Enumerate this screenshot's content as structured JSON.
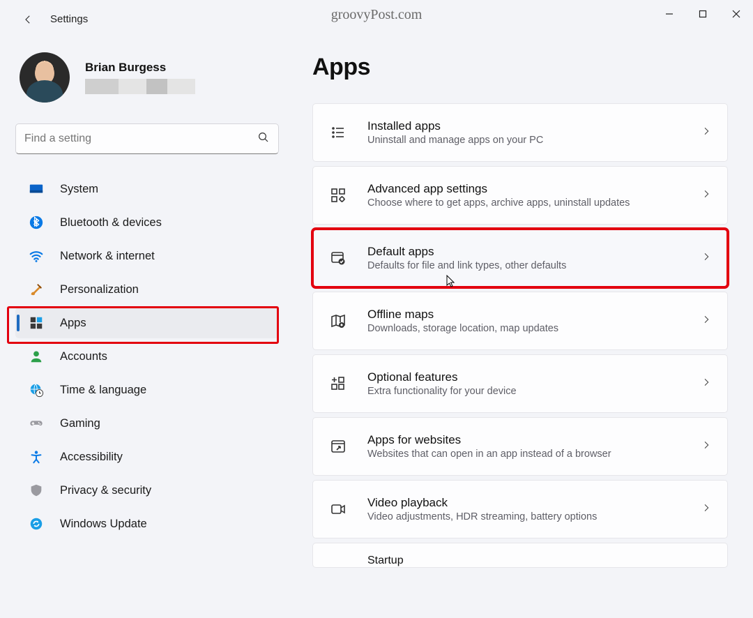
{
  "titlebar": {
    "title": "Settings"
  },
  "brand": "groovyPost.com",
  "user": {
    "name": "Brian Burgess"
  },
  "search": {
    "placeholder": "Find a setting"
  },
  "nav": [
    {
      "id": "system",
      "label": "System"
    },
    {
      "id": "bluetooth",
      "label": "Bluetooth & devices"
    },
    {
      "id": "network",
      "label": "Network & internet"
    },
    {
      "id": "personalization",
      "label": "Personalization"
    },
    {
      "id": "apps",
      "label": "Apps"
    },
    {
      "id": "accounts",
      "label": "Accounts"
    },
    {
      "id": "time",
      "label": "Time & language"
    },
    {
      "id": "gaming",
      "label": "Gaming"
    },
    {
      "id": "accessibility",
      "label": "Accessibility"
    },
    {
      "id": "privacy",
      "label": "Privacy & security"
    },
    {
      "id": "update",
      "label": "Windows Update"
    }
  ],
  "page": {
    "heading": "Apps"
  },
  "cards": [
    {
      "id": "installed",
      "title": "Installed apps",
      "sub": "Uninstall and manage apps on your PC"
    },
    {
      "id": "advanced",
      "title": "Advanced app settings",
      "sub": "Choose where to get apps, archive apps, uninstall updates"
    },
    {
      "id": "default",
      "title": "Default apps",
      "sub": "Defaults for file and link types, other defaults"
    },
    {
      "id": "offline",
      "title": "Offline maps",
      "sub": "Downloads, storage location, map updates"
    },
    {
      "id": "optional",
      "title": "Optional features",
      "sub": "Extra functionality for your device"
    },
    {
      "id": "websites",
      "title": "Apps for websites",
      "sub": "Websites that can open in an app instead of a browser"
    },
    {
      "id": "video",
      "title": "Video playback",
      "sub": "Video adjustments, HDR streaming, battery options"
    },
    {
      "id": "startup",
      "title": "Startup",
      "sub": ""
    }
  ],
  "highlight": {
    "nav_index": 4,
    "card_index": 2,
    "color": "#e3000f"
  }
}
